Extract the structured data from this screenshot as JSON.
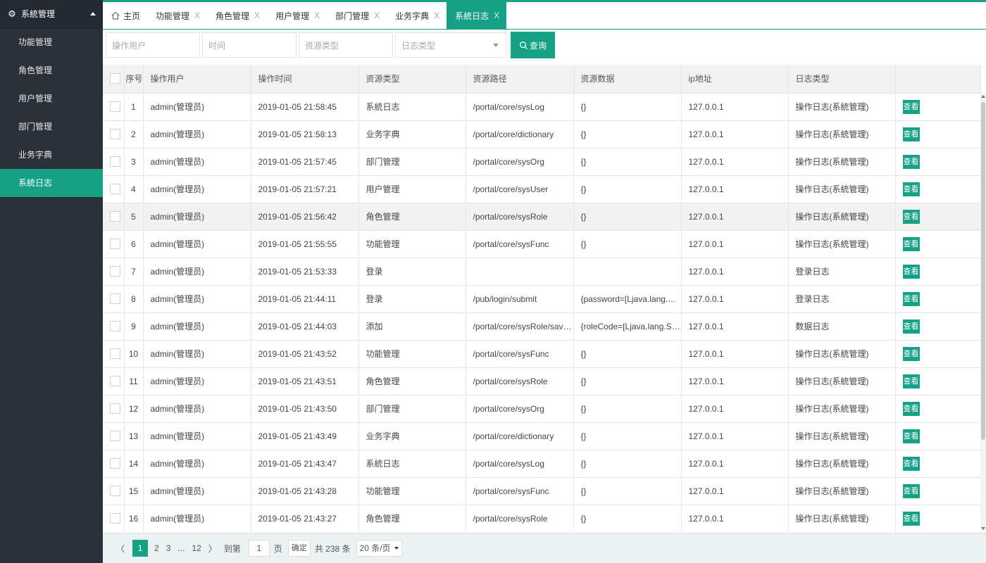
{
  "sidebar": {
    "header": "系統管理",
    "items": [
      {
        "label": "功能管理"
      },
      {
        "label": "角色管理"
      },
      {
        "label": "用户管理"
      },
      {
        "label": "部门管理"
      },
      {
        "label": "业务字典"
      },
      {
        "label": "系統日志",
        "active": true
      }
    ]
  },
  "tabs": [
    {
      "label": "主页",
      "closable": false
    },
    {
      "label": "功能管理",
      "closable": true
    },
    {
      "label": "角色管理",
      "closable": true
    },
    {
      "label": "用户管理",
      "closable": true
    },
    {
      "label": "部门管理",
      "closable": true
    },
    {
      "label": "业务字典",
      "closable": true
    },
    {
      "label": "系統日志",
      "closable": true,
      "active": true
    }
  ],
  "filter": {
    "user_placeholder": "操作用户",
    "time_placeholder": "时间",
    "resource_placeholder": "资源类型",
    "logtype_placeholder": "日志类型",
    "query_label": "查询"
  },
  "table": {
    "headers": [
      "序号",
      "操作用户",
      "操作时间",
      "资源类型",
      "资源路径",
      "资源数据",
      "ip地址",
      "日志类型",
      ""
    ],
    "view_label": "查看",
    "rows": [
      {
        "no": "1",
        "user": "admin(管理员)",
        "time": "2019-01-05 21:58:45",
        "rtype": "系統日志",
        "path": "/portal/core/sysLog",
        "data": "{}",
        "ip": "127.0.0.1",
        "ltype": "操作日志(系統管理)"
      },
      {
        "no": "2",
        "user": "admin(管理员)",
        "time": "2019-01-05 21:58:13",
        "rtype": "业务字典",
        "path": "/portal/core/dictionary",
        "data": "{}",
        "ip": "127.0.0.1",
        "ltype": "操作日志(系統管理)"
      },
      {
        "no": "3",
        "user": "admin(管理员)",
        "time": "2019-01-05 21:57:45",
        "rtype": "部门管理",
        "path": "/portal/core/sysOrg",
        "data": "{}",
        "ip": "127.0.0.1",
        "ltype": "操作日志(系統管理)"
      },
      {
        "no": "4",
        "user": "admin(管理员)",
        "time": "2019-01-05 21:57:21",
        "rtype": "用户管理",
        "path": "/portal/core/sysUser",
        "data": "{}",
        "ip": "127.0.0.1",
        "ltype": "操作日志(系統管理)"
      },
      {
        "no": "5",
        "user": "admin(管理员)",
        "time": "2019-01-05 21:56:42",
        "rtype": "角色管理",
        "path": "/portal/core/sysRole",
        "data": "{}",
        "ip": "127.0.0.1",
        "ltype": "操作日志(系統管理)",
        "hover": true
      },
      {
        "no": "6",
        "user": "admin(管理员)",
        "time": "2019-01-05 21:55:55",
        "rtype": "功能管理",
        "path": "/portal/core/sysFunc",
        "data": "{}",
        "ip": "127.0.0.1",
        "ltype": "操作日志(系統管理)"
      },
      {
        "no": "7",
        "user": "admin(管理员)",
        "time": "2019-01-05 21:53:33",
        "rtype": "登录",
        "path": "",
        "data": "",
        "ip": "127.0.0.1",
        "ltype": "登录日志"
      },
      {
        "no": "8",
        "user": "admin(管理员)",
        "time": "2019-01-05 21:44:11",
        "rtype": "登录",
        "path": "/pub/login/submit",
        "data": "{password=[Ljava.lang.St...",
        "ip": "127.0.0.1",
        "ltype": "登录日志"
      },
      {
        "no": "9",
        "user": "admin(管理员)",
        "time": "2019-01-05 21:44:03",
        "rtype": "添加",
        "path": "/portal/core/sysRole/save...",
        "data": "{roleCode=[Ljava.lang.St...",
        "ip": "127.0.0.1",
        "ltype": "数据日志"
      },
      {
        "no": "10",
        "user": "admin(管理员)",
        "time": "2019-01-05 21:43:52",
        "rtype": "功能管理",
        "path": "/portal/core/sysFunc",
        "data": "{}",
        "ip": "127.0.0.1",
        "ltype": "操作日志(系統管理)"
      },
      {
        "no": "11",
        "user": "admin(管理员)",
        "time": "2019-01-05 21:43:51",
        "rtype": "角色管理",
        "path": "/portal/core/sysRole",
        "data": "{}",
        "ip": "127.0.0.1",
        "ltype": "操作日志(系統管理)"
      },
      {
        "no": "12",
        "user": "admin(管理员)",
        "time": "2019-01-05 21:43:50",
        "rtype": "部门管理",
        "path": "/portal/core/sysOrg",
        "data": "{}",
        "ip": "127.0.0.1",
        "ltype": "操作日志(系統管理)"
      },
      {
        "no": "13",
        "user": "admin(管理员)",
        "time": "2019-01-05 21:43:49",
        "rtype": "业务字典",
        "path": "/portal/core/dictionary",
        "data": "{}",
        "ip": "127.0.0.1",
        "ltype": "操作日志(系統管理)"
      },
      {
        "no": "14",
        "user": "admin(管理员)",
        "time": "2019-01-05 21:43:47",
        "rtype": "系統日志",
        "path": "/portal/core/sysLog",
        "data": "{}",
        "ip": "127.0.0.1",
        "ltype": "操作日志(系統管理)"
      },
      {
        "no": "15",
        "user": "admin(管理员)",
        "time": "2019-01-05 21:43:28",
        "rtype": "功能管理",
        "path": "/portal/core/sysFunc",
        "data": "{}",
        "ip": "127.0.0.1",
        "ltype": "操作日志(系統管理)"
      },
      {
        "no": "16",
        "user": "admin(管理员)",
        "time": "2019-01-05 21:43:27",
        "rtype": "角色管理",
        "path": "/portal/core/sysRole",
        "data": "{}",
        "ip": "127.0.0.1",
        "ltype": "操作日志(系統管理)"
      }
    ]
  },
  "pager": {
    "prev": "〈",
    "current": "1",
    "pages": [
      "2",
      "3"
    ],
    "ellipsis": "...",
    "last": "12",
    "next": "〉",
    "goto_label": "到第",
    "goto_value": "1",
    "page_unit": "页",
    "ok_label": "确定",
    "total": "共 238 条",
    "size": "20 条/页"
  },
  "colors": {
    "accent": "#16a085",
    "sidebar_bg": "#2b3039"
  },
  "icons": {
    "sidebar_header": "gear-icon",
    "home_tab": "home-icon",
    "query": "search-icon"
  }
}
